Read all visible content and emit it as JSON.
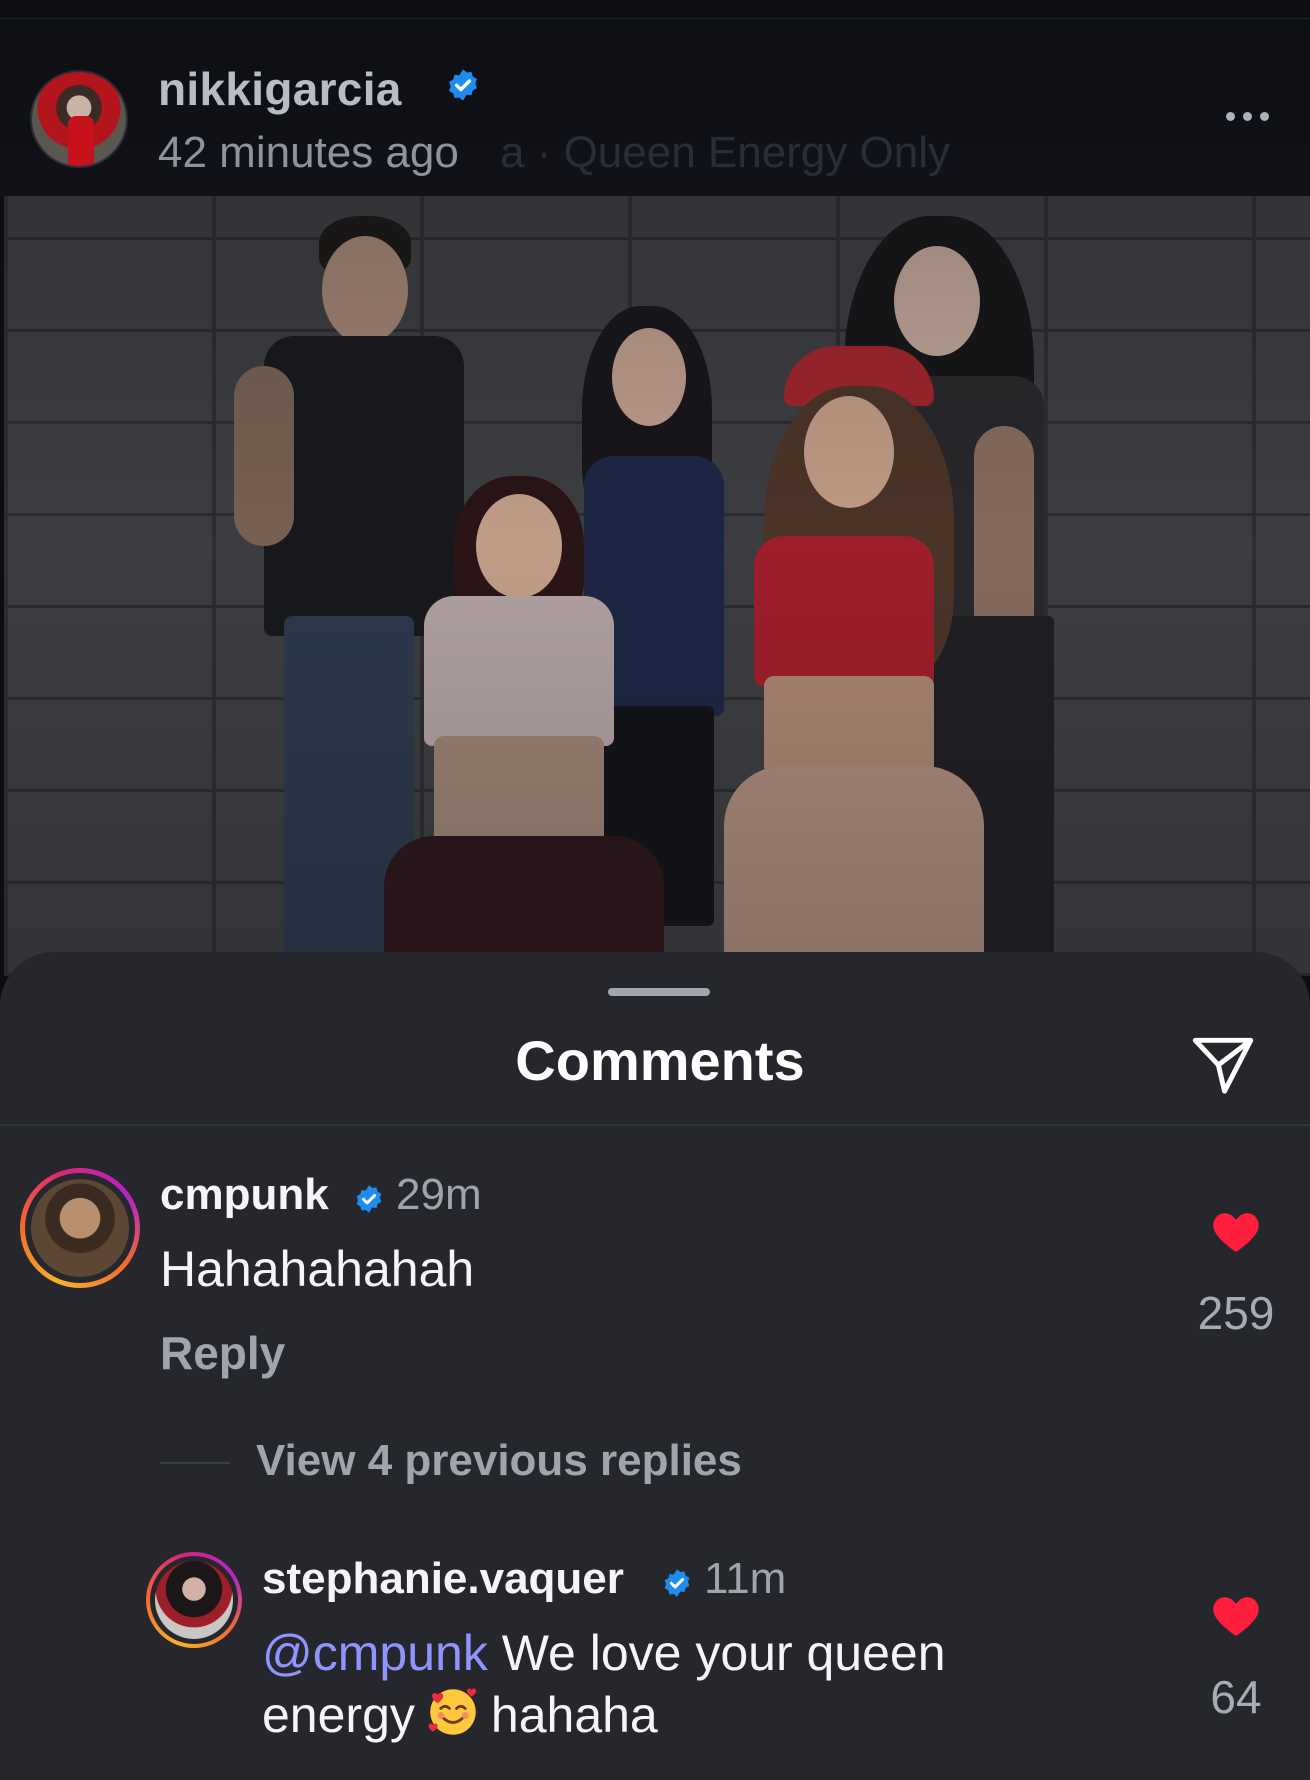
{
  "post": {
    "username": "nikkigarcia",
    "time": "42 minutes ago",
    "caption_preview": "a · Queen Energy Only",
    "more_icon": "more-horizontal-icon"
  },
  "photo": {
    "description_icon": "photo"
  },
  "comments_sheet": {
    "title": "Comments",
    "share_icon": "send-paper-plane-icon"
  },
  "comments": [
    {
      "username": "cmpunk",
      "time": "29m",
      "text": "Hahahahahah",
      "reply_label": "Reply",
      "like_count": "259",
      "liked": true,
      "view_replies": "View 4 previous replies"
    },
    {
      "username": "stephanie.vaquer",
      "time": "11m",
      "mention": "@cmpunk",
      "text_line1": " We love your queen",
      "text_line2_a": "energy",
      "emoji": "smiling-face-with-hearts",
      "text_line2_b": "hahaha",
      "like_count": "64",
      "liked": true
    }
  ],
  "colors": {
    "sheet_bg": "#25272c",
    "like_red": "#ff1f3d",
    "verified_blue": "#1d8cf0",
    "mention_purple": "#8e95ff"
  }
}
